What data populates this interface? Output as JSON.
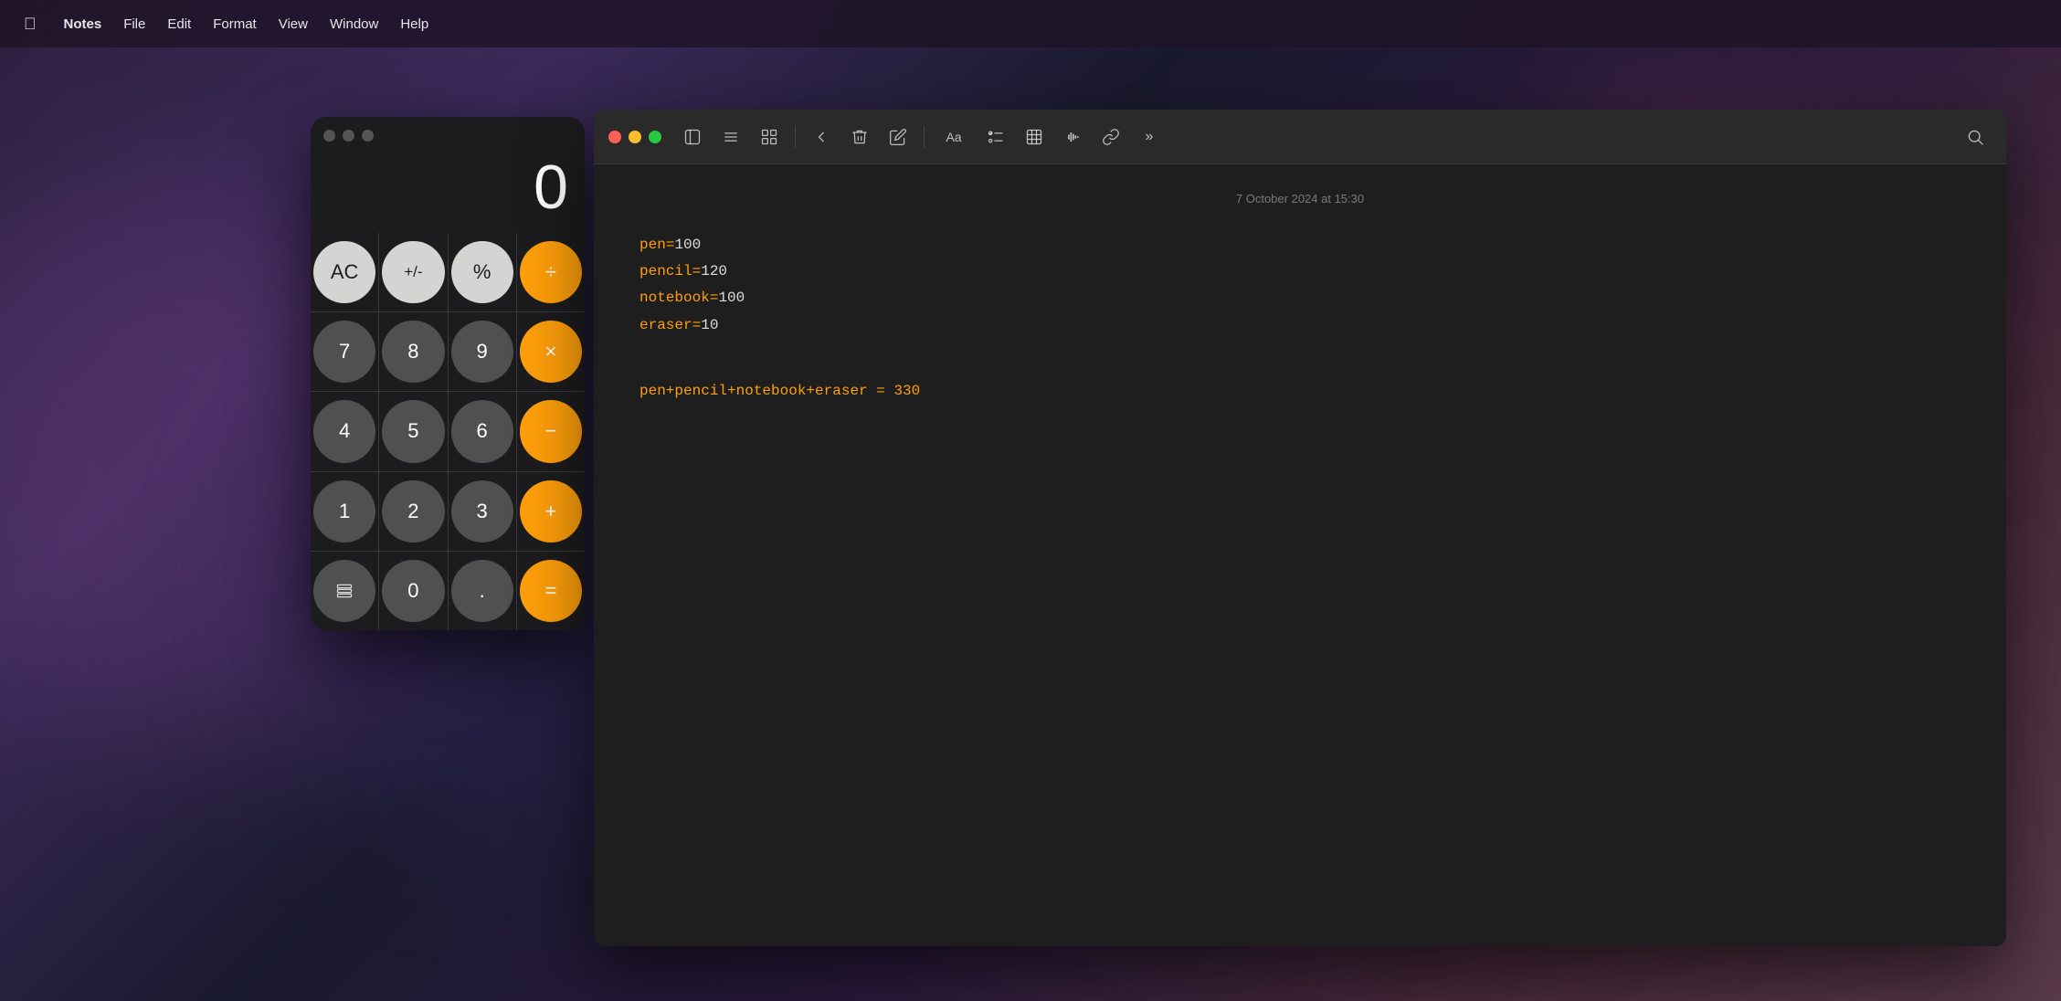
{
  "menubar": {
    "apple": "",
    "items": [
      {
        "id": "notes",
        "label": "Notes",
        "bold": true
      },
      {
        "id": "file",
        "label": "File"
      },
      {
        "id": "edit",
        "label": "Edit"
      },
      {
        "id": "format",
        "label": "Format"
      },
      {
        "id": "view",
        "label": "View"
      },
      {
        "id": "window",
        "label": "Window"
      },
      {
        "id": "help",
        "label": "Help"
      }
    ]
  },
  "calculator": {
    "display": "0",
    "buttons": [
      {
        "label": "AC",
        "type": "light",
        "row": 0,
        "col": 0
      },
      {
        "label": "+/-",
        "type": "light",
        "row": 0,
        "col": 1
      },
      {
        "label": "%",
        "type": "light",
        "row": 0,
        "col": 2
      },
      {
        "label": "÷",
        "type": "orange",
        "row": 0,
        "col": 3
      },
      {
        "label": "7",
        "type": "dark",
        "row": 1,
        "col": 0
      },
      {
        "label": "8",
        "type": "dark",
        "row": 1,
        "col": 1
      },
      {
        "label": "9",
        "type": "dark",
        "row": 1,
        "col": 2
      },
      {
        "label": "×",
        "type": "orange",
        "row": 1,
        "col": 3
      },
      {
        "label": "4",
        "type": "dark",
        "row": 2,
        "col": 0
      },
      {
        "label": "5",
        "type": "dark",
        "row": 2,
        "col": 1
      },
      {
        "label": "6",
        "type": "dark",
        "row": 2,
        "col": 2
      },
      {
        "label": "−",
        "type": "orange",
        "row": 2,
        "col": 3
      },
      {
        "label": "1",
        "type": "dark",
        "row": 3,
        "col": 0
      },
      {
        "label": "2",
        "type": "dark",
        "row": 3,
        "col": 1
      },
      {
        "label": "3",
        "type": "dark",
        "row": 3,
        "col": 2
      },
      {
        "label": "+",
        "type": "orange",
        "row": 3,
        "col": 3
      },
      {
        "label": "☰",
        "type": "dark",
        "row": 4,
        "col": 0
      },
      {
        "label": "0",
        "type": "dark",
        "row": 4,
        "col": 1
      },
      {
        "label": ".",
        "type": "dark",
        "row": 4,
        "col": 2
      },
      {
        "label": "=",
        "type": "orange",
        "row": 4,
        "col": 3
      }
    ]
  },
  "notes": {
    "timestamp": "7 October 2024 at 15:30",
    "lines": [
      {
        "content": "pen=100",
        "type": "orange_key_white_val",
        "key": "pen",
        "separator": "=",
        "value": "100"
      },
      {
        "content": "pencil=120",
        "type": "orange_key_white_val",
        "key": "pencil",
        "separator": "=",
        "value": "120"
      },
      {
        "content": "notebook=100",
        "type": "orange_key_white_val",
        "key": "notebook",
        "separator": "=",
        "value": "100"
      },
      {
        "content": "eraser=10",
        "type": "orange_key_white_val",
        "key": "eraser",
        "separator": "=",
        "value": "10"
      }
    ],
    "formula": {
      "prefix": "pen+pencil+notebook+eraser = ",
      "result": "330"
    }
  }
}
